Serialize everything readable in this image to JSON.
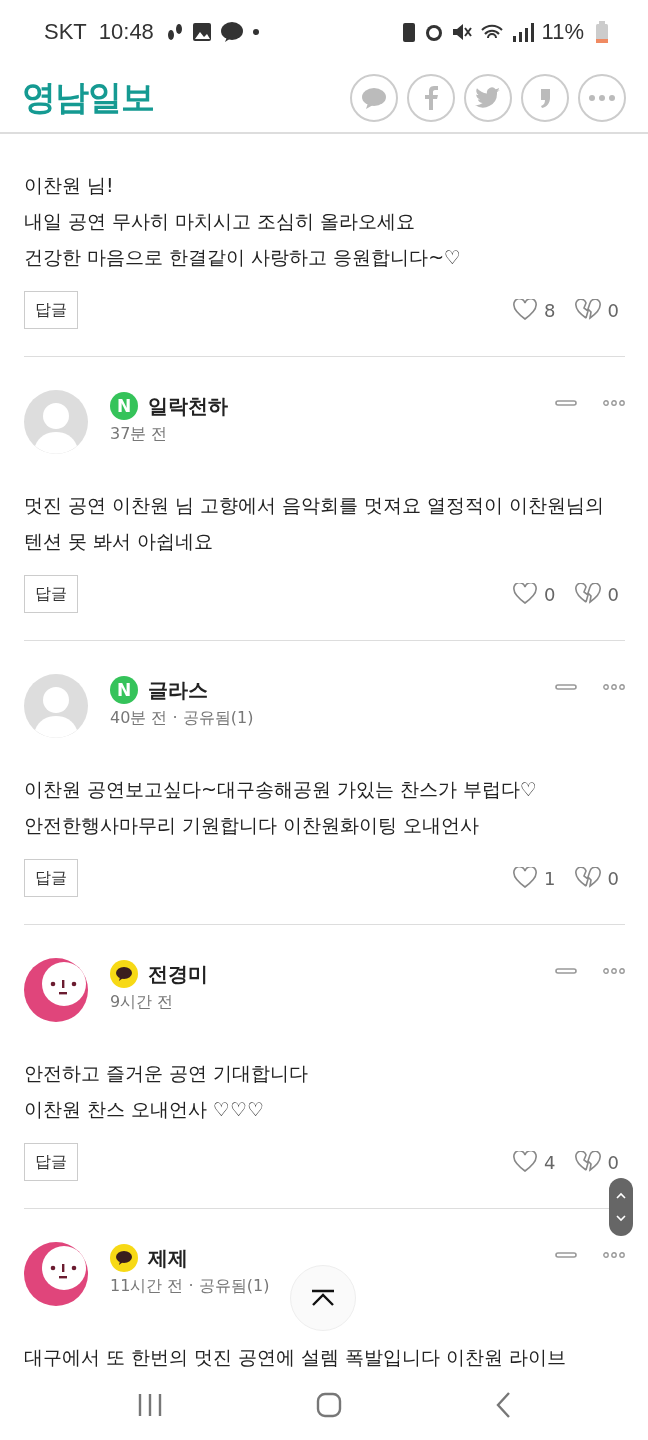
{
  "status_bar": {
    "carrier": "SKT",
    "time": "10:48",
    "battery": "11%"
  },
  "header": {
    "logo": "영남일보"
  },
  "comments": [
    {
      "text": [
        "이찬원 님!",
        "내일 공연 무사히 마치시고 조심히 올라오세요",
        "건강한 마음으로 한결같이 사랑하고 응원합니다~♡"
      ],
      "reply": "답글",
      "likes": "8",
      "dislikes": "0"
    },
    {
      "provider": {
        "kind": "naver",
        "mark": "N"
      },
      "avatar": {
        "kind": "default"
      },
      "name": "일락천하",
      "meta": "37분 전",
      "text": [
        "멋진 공연 이찬원 님 고향에서 음악회를 멋져요 열정적이 이찬원님의 텐션 못 봐서 아쉽네요"
      ],
      "reply": "답글",
      "likes": "0",
      "dislikes": "0"
    },
    {
      "provider": {
        "kind": "naver",
        "mark": "N"
      },
      "avatar": {
        "kind": "default"
      },
      "name": "글라스",
      "meta": "40분 전 · 공유됨(1)",
      "text": [
        "이찬원 공연보고싶다~대구송해공원 가있는 찬스가 부럽다♡",
        "안전한행사마무리 기원합니다 이찬원화이팅 오내언사"
      ],
      "reply": "답글",
      "likes": "1",
      "dislikes": "0"
    },
    {
      "provider": {
        "kind": "kakao"
      },
      "avatar": {
        "kind": "kakao"
      },
      "name": "전경미",
      "meta": "9시간 전",
      "text": [
        "안전하고 즐거운 공연 기대합니다",
        "이찬원 찬스 오내언사 ♡♡♡"
      ],
      "reply": "답글",
      "likes": "4",
      "dislikes": "0"
    },
    {
      "provider": {
        "kind": "kakao"
      },
      "avatar": {
        "kind": "kakao"
      },
      "name": "제제",
      "meta": "11시간 전 · 공유됨(1)",
      "text": [
        "대구에서 또 한번의 멋진 공연에 설렘 폭발입니다 이찬원 라이브"
      ]
    }
  ]
}
